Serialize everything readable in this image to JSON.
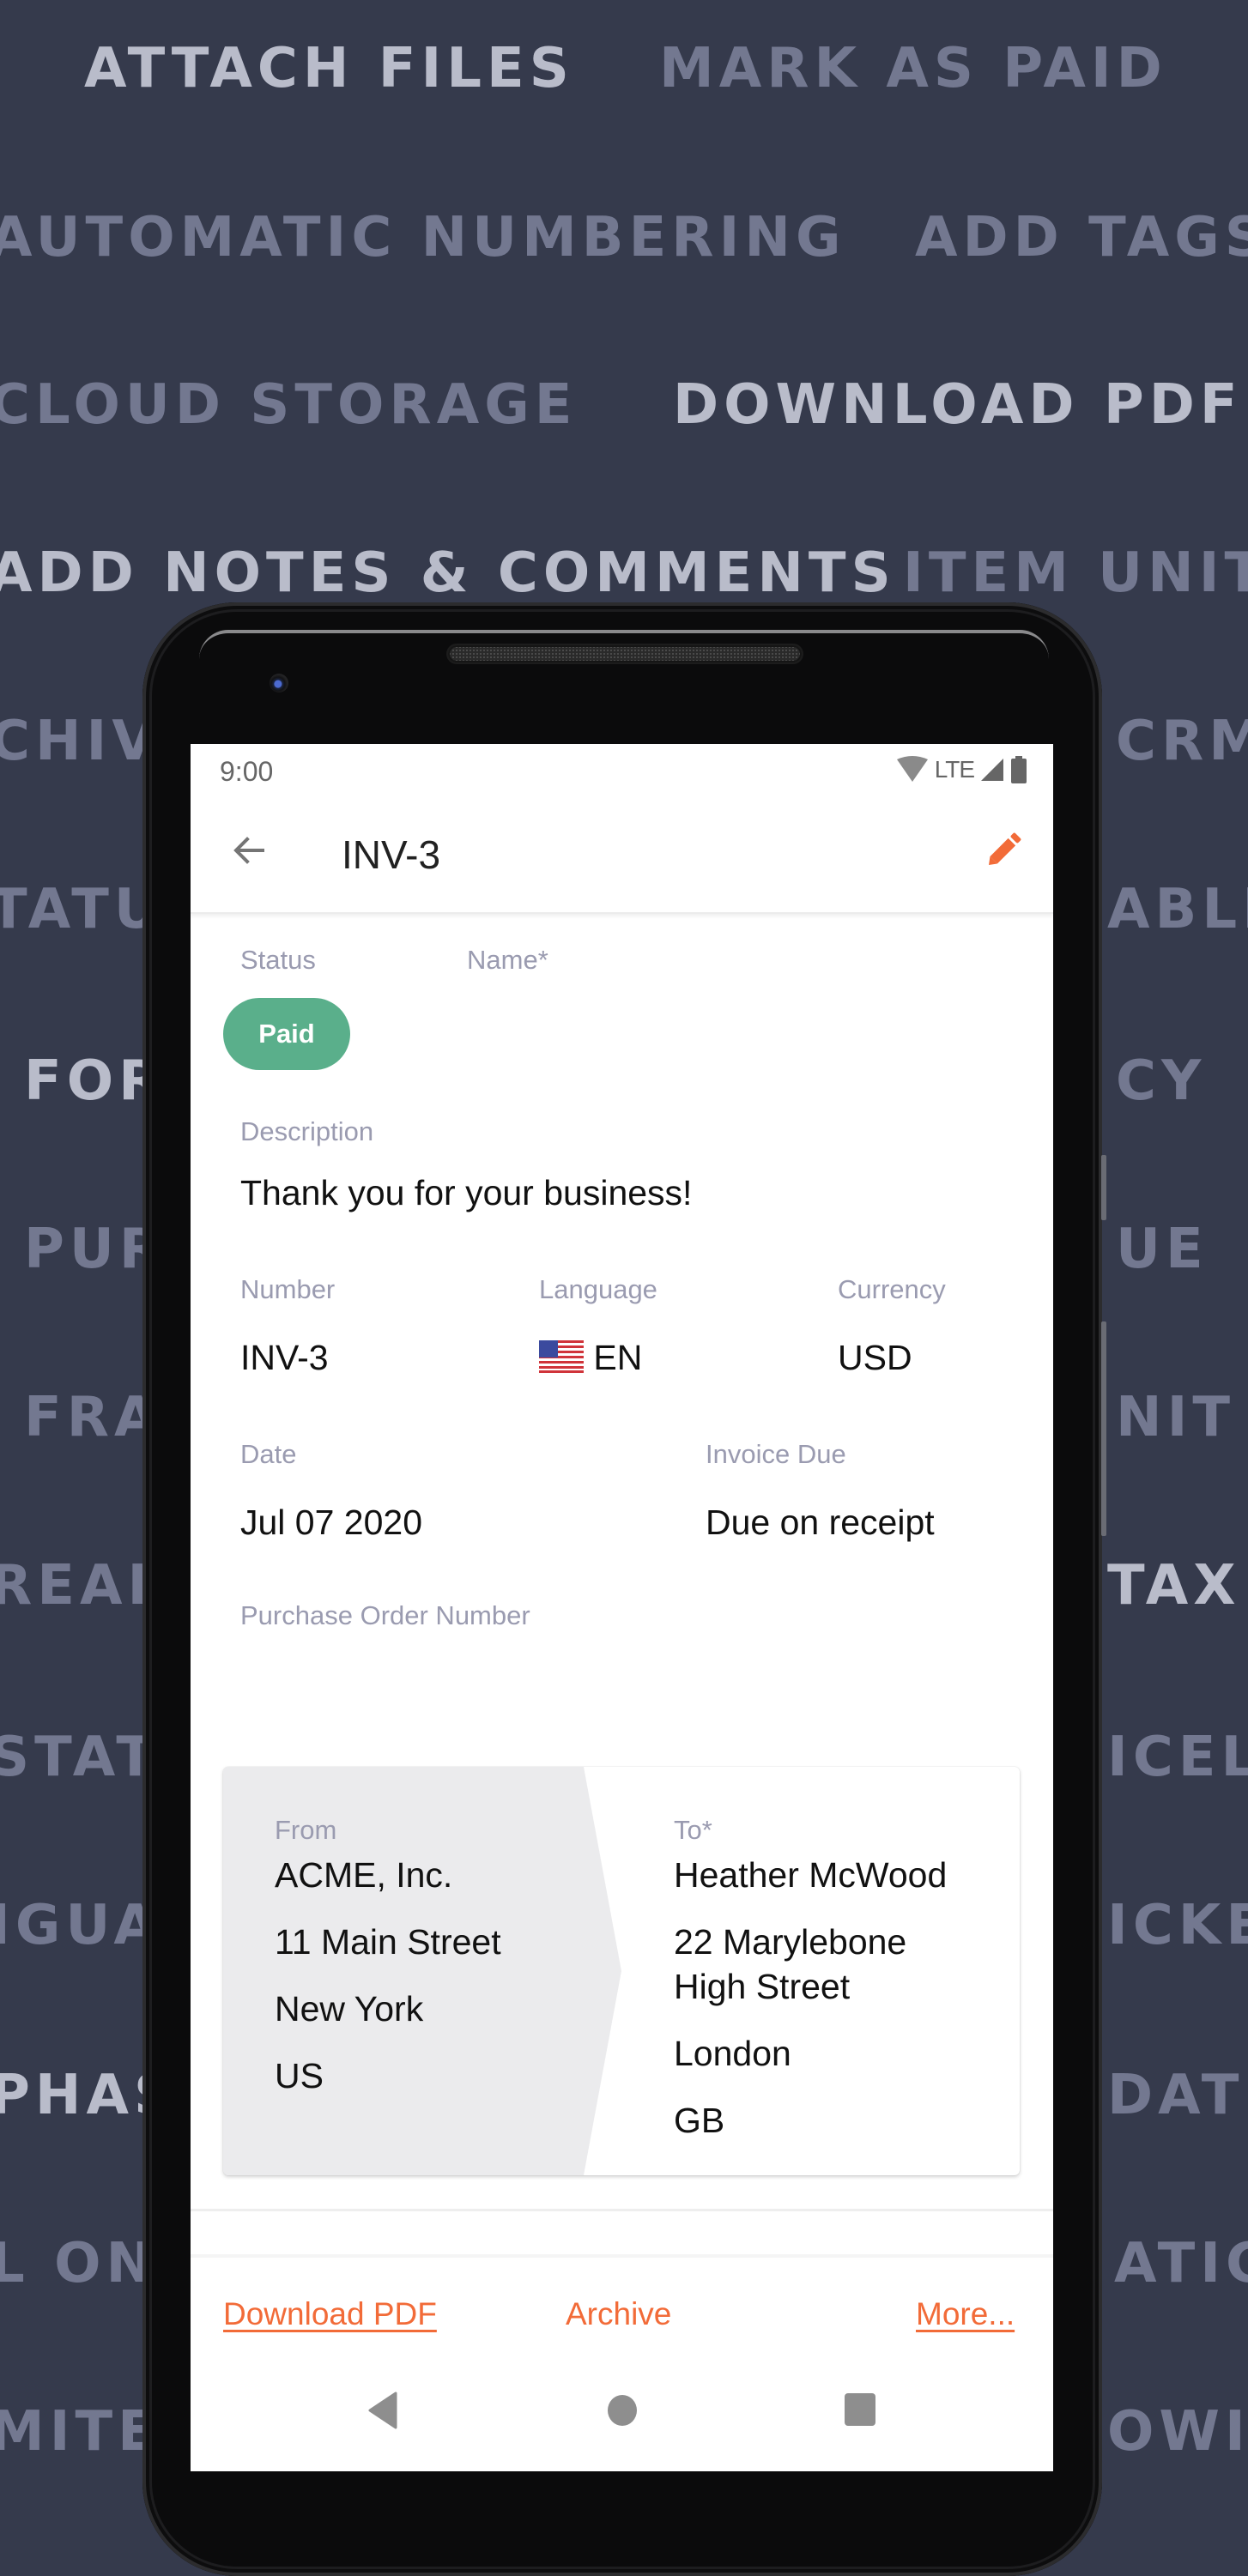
{
  "background_features": [
    {
      "text": "ATTACH FILES",
      "tone": "light"
    },
    {
      "text": "MARK AS PAID",
      "tone": "dim"
    },
    {
      "text": "AUTOMATIC NUMBERING",
      "tone": "dim"
    },
    {
      "text": "ADD TAGS",
      "tone": "dim"
    },
    {
      "text": "CLOUD STORAGE",
      "tone": "dim"
    },
    {
      "text": "DOWNLOAD PDF",
      "tone": "light"
    },
    {
      "text": "ADD NOTES & COMMENTS",
      "tone": "light"
    },
    {
      "text": "ITEM UNIT",
      "tone": "dim"
    },
    {
      "text": "CHIV",
      "tone": "dim"
    },
    {
      "text": "CRM",
      "tone": "dim"
    },
    {
      "text": "TATU",
      "tone": "dim"
    },
    {
      "text": "ABLI",
      "tone": "dim"
    },
    {
      "text": "FOR",
      "tone": "light"
    },
    {
      "text": "CY",
      "tone": "dim"
    },
    {
      "text": "PUR",
      "tone": "dim"
    },
    {
      "text": "UE",
      "tone": "dim"
    },
    {
      "text": "FRA",
      "tone": "dim"
    },
    {
      "text": "NIT",
      "tone": "dim"
    },
    {
      "text": "REAI",
      "tone": "dim"
    },
    {
      "text": "TAX",
      "tone": "light"
    },
    {
      "text": "STAT",
      "tone": "dim"
    },
    {
      "text": "ICEL",
      "tone": "dim"
    },
    {
      "text": "IGUA",
      "tone": "dim"
    },
    {
      "text": "ICKE",
      "tone": "dim"
    },
    {
      "text": "PHAS",
      "tone": "light"
    },
    {
      "text": "DATI",
      "tone": "dim"
    },
    {
      "text": "L ON",
      "tone": "dim"
    },
    {
      "text": "ATIC",
      "tone": "dim"
    },
    {
      "text": "MITE",
      "tone": "dim"
    },
    {
      "text": "OWI",
      "tone": "dim"
    }
  ],
  "status_bar": {
    "time": "9:00",
    "network": "LTE",
    "icons": [
      "wifi-icon",
      "signal-icon",
      "battery-icon"
    ]
  },
  "app_bar": {
    "title": "INV-3",
    "back_icon": "arrow-left-icon",
    "edit_icon": "pencil-icon"
  },
  "invoice": {
    "status_label": "Status",
    "status_value": "Paid",
    "name_label": "Name*",
    "name_value": "",
    "description_label": "Description",
    "description_value": "Thank you for your business!",
    "number_label": "Number",
    "number_value": "INV-3",
    "language_label": "Language",
    "language_flag": "🇺🇸",
    "language_value": "EN",
    "currency_label": "Currency",
    "currency_value": "USD",
    "date_label": "Date",
    "date_value": "Jul 07 2020",
    "due_label": "Invoice Due",
    "due_value": "Due on receipt",
    "po_label": "Purchase Order Number",
    "po_value": ""
  },
  "addresses": {
    "from_label": "From",
    "from_lines": [
      "ACME, Inc.",
      "11 Main Street",
      "New York",
      "US"
    ],
    "to_label": "To*",
    "to_lines": [
      "Heather McWood",
      "22 Marylebone High Street",
      "London",
      "GB"
    ]
  },
  "actions": {
    "download_pdf": "Download PDF",
    "archive": "Archive",
    "more": "More..."
  },
  "colors": {
    "background": "#353a4c",
    "accent": "#f26b38",
    "paid_badge": "#5aaf8b",
    "label": "#9a9bb0"
  }
}
